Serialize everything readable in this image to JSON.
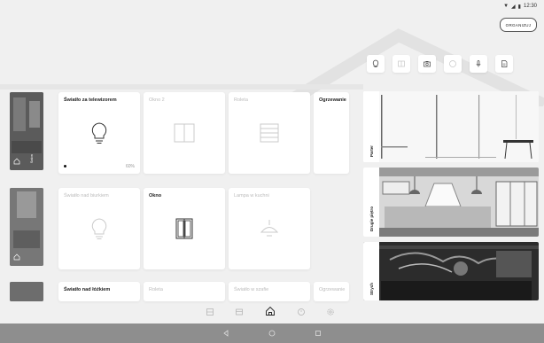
{
  "status_bar": {
    "time": "12:30"
  },
  "header": {
    "organize_label": "ORGANIZUJ"
  },
  "filters": [
    {
      "icon": "bulb-icon",
      "active": true
    },
    {
      "icon": "window-icon",
      "active": false
    },
    {
      "icon": "camera-icon",
      "active": true
    },
    {
      "icon": "thermostat-icon",
      "active": false
    },
    {
      "icon": "microphone-icon",
      "active": true
    },
    {
      "icon": "document-icon",
      "active": true
    }
  ],
  "rows": [
    {
      "room_label": "Salon",
      "tiles": [
        {
          "title": "Światło za telewizorem",
          "active": true,
          "icon": "bulb-icon",
          "value": "60%"
        },
        {
          "title": "Okno 2",
          "active": false,
          "icon": "window-icon"
        },
        {
          "title": "Roleta",
          "active": false,
          "icon": "blind-icon"
        },
        {
          "title": "Ogrzewanie",
          "active": true,
          "icon": "none"
        }
      ]
    },
    {
      "room_label": "",
      "tiles": [
        {
          "title": "Światło nad biurkiem",
          "active": false,
          "icon": "bulb-icon"
        },
        {
          "title": "Okno",
          "active": true,
          "icon": "window-icon"
        },
        {
          "title": "Lampa w kuchni",
          "active": false,
          "icon": "lamp-icon"
        }
      ]
    },
    {
      "room_label": "",
      "tiles": [
        {
          "title": "Światło nad łóżkiem",
          "active": true
        },
        {
          "title": "Roleta",
          "active": false
        },
        {
          "title": "Światło w szafie",
          "active": false
        },
        {
          "title": "Ogrzewanie",
          "active": false
        }
      ]
    }
  ],
  "side_rooms": [
    {
      "label": "Parter"
    },
    {
      "label": "Drugie piętro"
    },
    {
      "label": "Strych"
    }
  ],
  "bottom_nav": [
    {
      "icon": "grid-icon",
      "active": false
    },
    {
      "icon": "window-nav-icon",
      "active": false
    },
    {
      "icon": "home-icon",
      "active": true
    },
    {
      "icon": "timer-icon",
      "active": false
    },
    {
      "icon": "settings-icon",
      "active": false
    }
  ]
}
